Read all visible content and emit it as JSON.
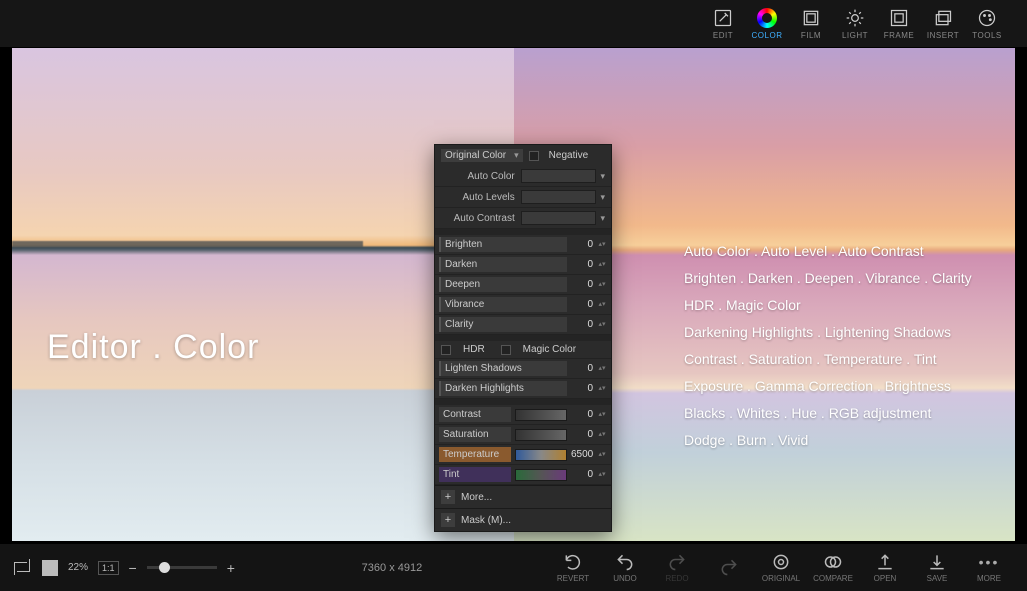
{
  "topbar": {
    "items": [
      {
        "name": "edit",
        "label": "EDIT"
      },
      {
        "name": "color",
        "label": "COLOR",
        "active": true
      },
      {
        "name": "film",
        "label": "FILM"
      },
      {
        "name": "light",
        "label": "LIGHT"
      },
      {
        "name": "frame",
        "label": "FRAME"
      },
      {
        "name": "insert",
        "label": "INSERT"
      },
      {
        "name": "tools",
        "label": "TOOLS"
      }
    ]
  },
  "title": "Editor . Color",
  "features": [
    "Auto Color . Auto Level . Auto Contrast",
    "Brighten . Darken . Deepen .  Vibrance . Clarity",
    "HDR . Magic Color",
    "Darkening Highlights . Lightening Shadows",
    "Contrast . Saturation . Temperature . Tint",
    "Exposure . Gamma Correction . Brightness",
    "Blacks . Whites . Hue . RGB adjustment",
    "Dodge . Burn . Vivid"
  ],
  "panel": {
    "mode": "Original Color",
    "negative": "Negative",
    "auto": [
      {
        "label": "Auto Color"
      },
      {
        "label": "Auto Levels"
      },
      {
        "label": "Auto Contrast"
      }
    ],
    "basic": [
      {
        "label": "Brighten",
        "value": "0"
      },
      {
        "label": "Darken",
        "value": "0"
      },
      {
        "label": "Deepen",
        "value": "0"
      },
      {
        "label": "Vibrance",
        "value": "0"
      },
      {
        "label": "Clarity",
        "value": "0"
      }
    ],
    "hdr": "HDR",
    "magic": "Magic Color",
    "shadows": [
      {
        "label": "Lighten Shadows",
        "value": "0"
      },
      {
        "label": "Darken Highlights",
        "value": "0"
      }
    ],
    "csSliders": [
      {
        "label": "Contrast",
        "value": "0",
        "cls": ""
      },
      {
        "label": "Saturation",
        "value": "0",
        "cls": ""
      },
      {
        "label": "Temperature",
        "value": "6500",
        "cls": "temp"
      },
      {
        "label": "Tint",
        "value": "0",
        "cls": "tint"
      }
    ],
    "more": "More...",
    "mask": "Mask (M)..."
  },
  "bottombar": {
    "zoom": "22%",
    "fit": "1:1",
    "dims": "7360 x 4912",
    "actions": [
      {
        "name": "revert",
        "label": "REVERT"
      },
      {
        "name": "undo",
        "label": "UNDO"
      },
      {
        "name": "redo",
        "label": "REDO",
        "disabled": true
      },
      {
        "name": "redo2",
        "label": "",
        "disabled": true
      },
      {
        "name": "original",
        "label": "ORIGINAL"
      },
      {
        "name": "compare",
        "label": "COMPARE"
      },
      {
        "name": "open",
        "label": "OPEN"
      },
      {
        "name": "save",
        "label": "SAVE"
      },
      {
        "name": "more",
        "label": "MORE"
      }
    ]
  }
}
